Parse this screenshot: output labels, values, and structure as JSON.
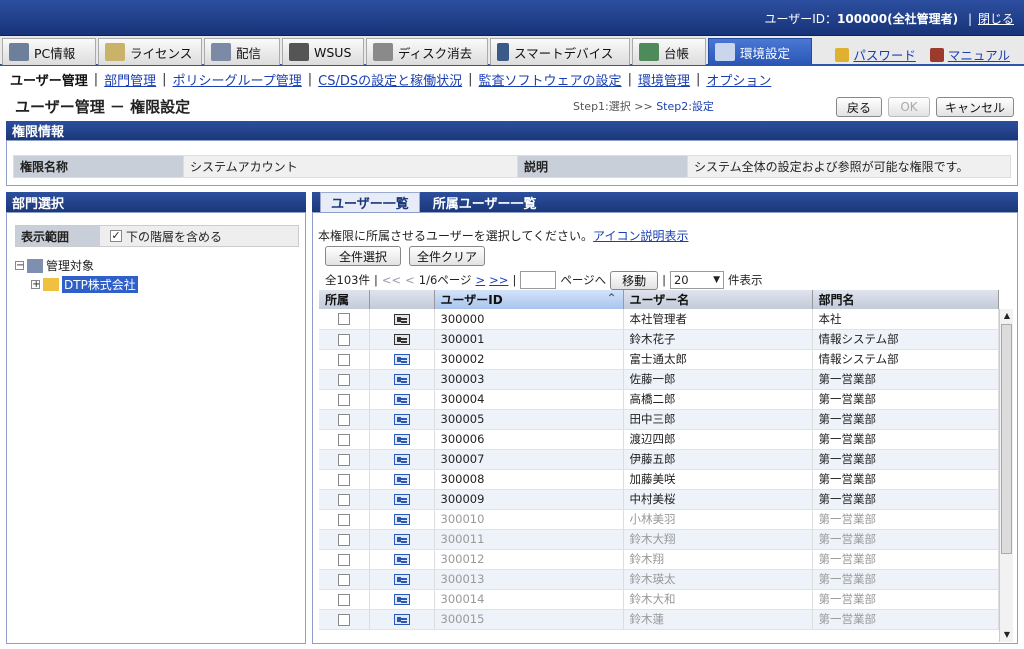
{
  "header": {
    "user_label": "ユーザーID：",
    "user_value": "100000(全社管理者)",
    "close": "閉じる"
  },
  "tabs": [
    {
      "label": "PC情報",
      "icon": "pc-icon"
    },
    {
      "label": "ライセンス",
      "icon": "license-icon"
    },
    {
      "label": "配信",
      "icon": "distribute-icon"
    },
    {
      "label": "WSUS",
      "icon": "wsus-icon"
    },
    {
      "label": "ディスク消去",
      "icon": "disk-erase-icon"
    },
    {
      "label": "スマートデバイス",
      "icon": "smart-device-icon"
    },
    {
      "label": "台帳",
      "icon": "ledger-icon"
    },
    {
      "label": "環境設定",
      "icon": "settings-icon"
    }
  ],
  "toplinks": {
    "password": "パスワード",
    "manual": "マニュアル"
  },
  "subnav": [
    "ユーザー管理",
    "部門管理",
    "ポリシーグループ管理",
    "CS/DSの設定と稼働状況",
    "監査ソフトウェアの設定",
    "環境管理",
    "オプション"
  ],
  "page": {
    "title": "ユーザー管理 － 権限設定",
    "step1": "Step1:選択",
    "arrow": ">>",
    "step2": "Step2:設定",
    "back": "戻る",
    "ok": "OK",
    "cancel": "キャンセル"
  },
  "authority": {
    "heading": "権限情報",
    "name_label": "権限名称",
    "name_value": "システムアカウント",
    "desc_label": "説明",
    "desc_value": "システム全体の設定および参照が可能な権限です。"
  },
  "dept": {
    "heading": "部門選択",
    "range_label": "表示範囲",
    "include_label": "下の階層を含める",
    "include_checked": true,
    "root": "管理対象",
    "child": "DTP株式会社"
  },
  "users": {
    "tab1": "ユーザー一覧",
    "tab2": "所属ユーザー一覧",
    "instruction": "本権限に所属させるユーザーを選択してください。",
    "icon_link": "アイコン説明表示",
    "select_all": "全件選択",
    "clear_all": "全件クリア",
    "total": "全103件",
    "first": "<<",
    "prev": "<",
    "page_info": "1/6ページ",
    "next": ">",
    "last": ">>",
    "page_suffix": "ページへ",
    "move": "移動",
    "per_page": "20",
    "per_page_suffix": "件表示",
    "columns": {
      "member": "所属",
      "id": "ユーザーID",
      "name": "ユーザー名",
      "dept": "部門名"
    },
    "rows": [
      {
        "id": "300000",
        "name": "本社管理者",
        "dept": "本社",
        "admin": true,
        "dim": false
      },
      {
        "id": "300001",
        "name": "鈴木花子",
        "dept": "情報システム部",
        "admin": true,
        "dim": false
      },
      {
        "id": "300002",
        "name": "富士通太郎",
        "dept": "情報システム部",
        "admin": false,
        "dim": false
      },
      {
        "id": "300003",
        "name": "佐藤一郎",
        "dept": "第一営業部",
        "admin": false,
        "dim": false
      },
      {
        "id": "300004",
        "name": "高橋二郎",
        "dept": "第一営業部",
        "admin": false,
        "dim": false
      },
      {
        "id": "300005",
        "name": "田中三郎",
        "dept": "第一営業部",
        "admin": false,
        "dim": false
      },
      {
        "id": "300006",
        "name": "渡辺四郎",
        "dept": "第一営業部",
        "admin": false,
        "dim": false
      },
      {
        "id": "300007",
        "name": "伊藤五郎",
        "dept": "第一営業部",
        "admin": false,
        "dim": false
      },
      {
        "id": "300008",
        "name": "加藤美咲",
        "dept": "第一営業部",
        "admin": false,
        "dim": false
      },
      {
        "id": "300009",
        "name": "中村美桜",
        "dept": "第一営業部",
        "admin": false,
        "dim": false
      },
      {
        "id": "300010",
        "name": "小林美羽",
        "dept": "第一営業部",
        "admin": false,
        "dim": true
      },
      {
        "id": "300011",
        "name": "鈴木大翔",
        "dept": "第一営業部",
        "admin": false,
        "dim": true
      },
      {
        "id": "300012",
        "name": "鈴木翔",
        "dept": "第一営業部",
        "admin": false,
        "dim": true
      },
      {
        "id": "300013",
        "name": "鈴木瑛太",
        "dept": "第一営業部",
        "admin": false,
        "dim": true
      },
      {
        "id": "300014",
        "name": "鈴木大和",
        "dept": "第一営業部",
        "admin": false,
        "dim": true
      },
      {
        "id": "300015",
        "name": "鈴木蓮",
        "dept": "第一営業部",
        "admin": false,
        "dim": true
      }
    ]
  }
}
